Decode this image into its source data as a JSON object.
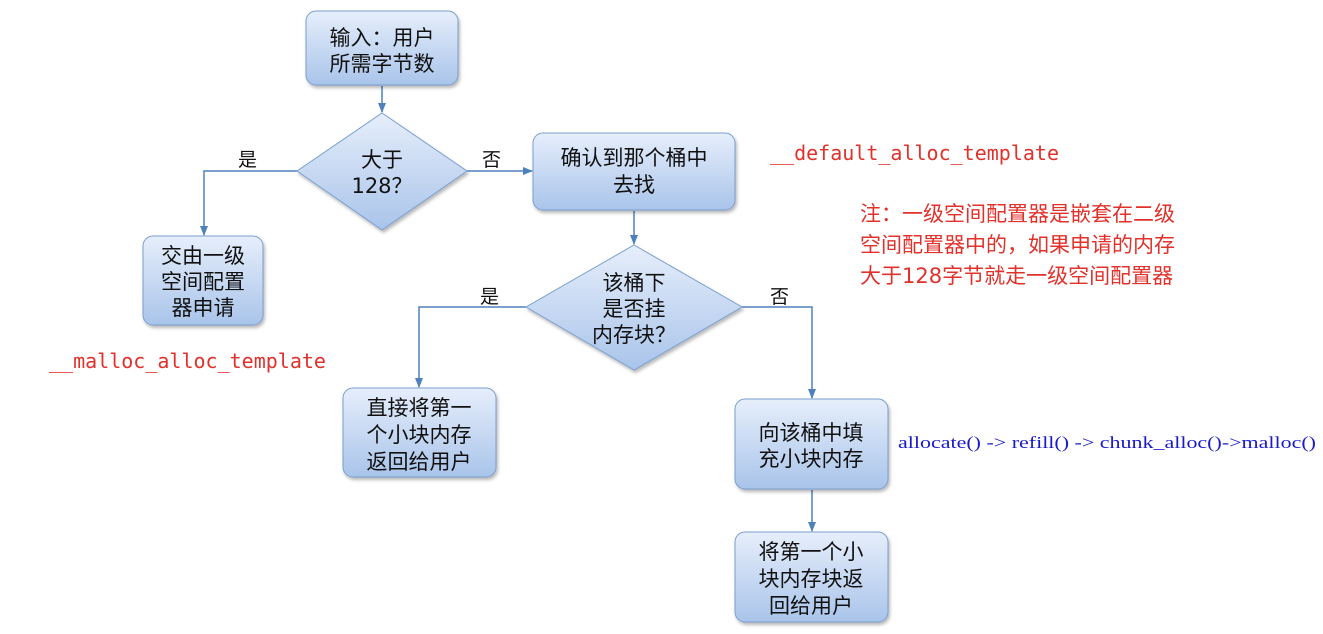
{
  "nodes": {
    "input": [
      "输入：用户",
      "所需字节数"
    ],
    "decision_128": [
      "大于",
      "128？"
    ],
    "level1": [
      "交由一级",
      "空间配置",
      "器申请"
    ],
    "find_bucket": [
      "确认到那个桶中",
      "去找"
    ],
    "decision_block": [
      "该桶下",
      "是否挂",
      "内存块？"
    ],
    "return_direct": [
      "直接将第一",
      "个小块内存",
      "返回给用户"
    ],
    "refill": [
      "向该桶中填",
      "充小块内存"
    ],
    "return_after": [
      "将第一个小",
      "块内存块返",
      "回给用户"
    ]
  },
  "edge_labels": {
    "yes_left": "是",
    "no_right": "否",
    "yes_left_2": "是",
    "no_right_2": "否"
  },
  "annotations": {
    "default_alloc": "__default_alloc_template",
    "malloc_alloc": "__malloc_alloc_template",
    "note_lines": [
      "注：一级空间配置器是嵌套在二级",
      "空间配置器中的，如果申请的内存",
      "大于128字节就走一级空间配置器"
    ],
    "call_chain": "allocate() -> refill() -> chunk_alloc()->malloc()"
  },
  "colors": {
    "node_fill_top": "#e6eefb",
    "node_fill_bottom": "#a9c4ea",
    "node_stroke": "#7a9fd1",
    "edge": "#4f81bd",
    "red_text": "#e0312b",
    "blue_text": "#1a1acc"
  }
}
